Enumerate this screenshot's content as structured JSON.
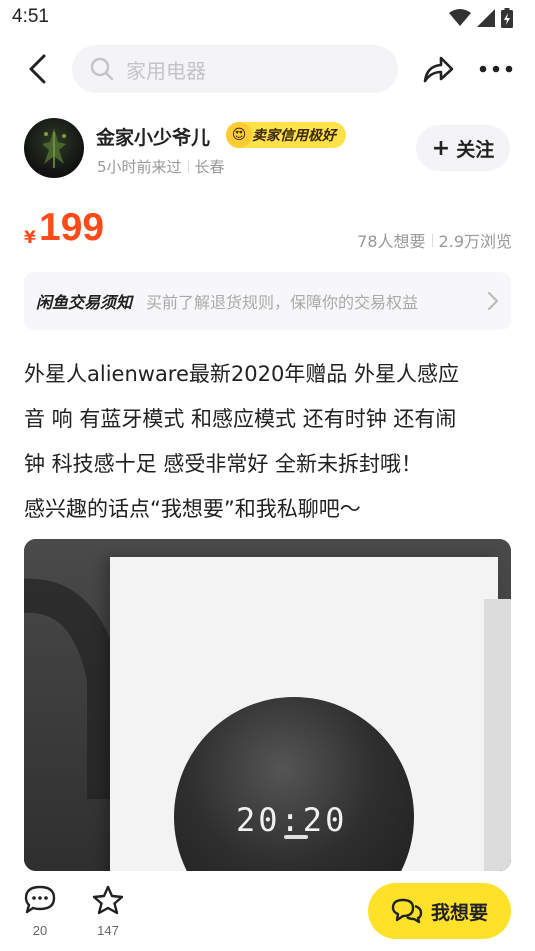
{
  "status_bar": {
    "time": "4:51"
  },
  "search": {
    "placeholder": "家用电器"
  },
  "seller": {
    "name": "金家小少爷儿",
    "credit_badge": "卖家信用极好",
    "last_seen": "5小时前来过",
    "location": "长春",
    "follow_label": "关注"
  },
  "price": {
    "currency": "¥",
    "amount": "199",
    "wants": "78人想要",
    "views": "2.9万浏览",
    "color": "#ff4b19"
  },
  "notice": {
    "title": "闲鱼交易须知",
    "text": "买前了解退货规则，保障你的交易权益"
  },
  "description": [
    "外星人alienware最新2020年赠品   外星人感应",
    "音 响 有蓝牙模式 和感应模式  还有时钟 还有闹",
    "钟  科技感十足  感受非常好  全新未拆封哦！",
    "感兴趣的话点“我想要”和我私聊吧～"
  ],
  "photo": {
    "clock_text": "20:20"
  },
  "bottom_bar": {
    "comments": "20",
    "favorites": "147",
    "want_label": "我想要",
    "want_color": "#ffe12a"
  },
  "icons": [
    "signal-icon",
    "battery-icon",
    "back-icon",
    "search-icon",
    "share-icon",
    "more-icon",
    "plus-icon",
    "chevron-right-icon",
    "comment-icon",
    "star-icon",
    "chat-bubbles-icon"
  ]
}
